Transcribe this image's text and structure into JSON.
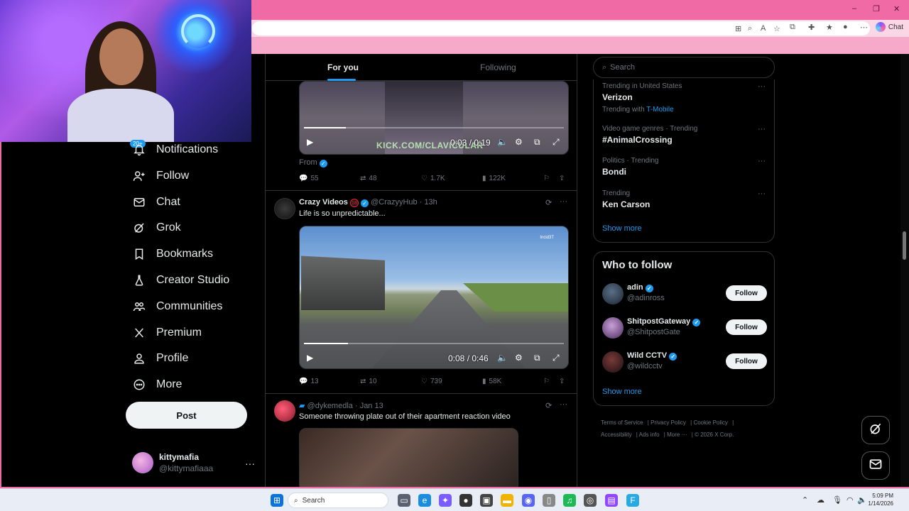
{
  "browser": {
    "chat_label": "Chat",
    "window_controls": [
      "–",
      "❐",
      "✕"
    ]
  },
  "nav": {
    "notifications_badge": "20+",
    "items": [
      {
        "label": "Notifications",
        "icon": "bell-icon"
      },
      {
        "label": "Follow",
        "icon": "person-plus-icon"
      },
      {
        "label": "Chat",
        "icon": "mail-icon"
      },
      {
        "label": "Grok",
        "icon": "grok-icon"
      },
      {
        "label": "Bookmarks",
        "icon": "bookmark-icon"
      },
      {
        "label": "Creator Studio",
        "icon": "flask-icon"
      },
      {
        "label": "Communities",
        "icon": "people-icon"
      },
      {
        "label": "Premium",
        "icon": "x-logo-icon"
      },
      {
        "label": "Profile",
        "icon": "person-icon"
      },
      {
        "label": "More",
        "icon": "more-circle-icon"
      }
    ],
    "post_label": "Post",
    "account": {
      "name": "kittymafia",
      "handle": "@kittymafiaaa"
    }
  },
  "timeline": {
    "tabs": {
      "active": "For you",
      "inactive": "Following"
    },
    "post1": {
      "video_time": "0:03 / 0:19",
      "progress": 0.16,
      "watermark": "KICK.COM/CLAVICULAR",
      "from_label": "From",
      "replies": "55",
      "reposts": "48",
      "likes": "1.7K",
      "views": "122K"
    },
    "post2": {
      "name": "Crazy Videos",
      "age_badge": "18",
      "handle": "@CrazyyHub",
      "time": "· 13h",
      "text": "Life is so unpredictable...",
      "watermark": "Incid3T",
      "video_time": "0:08 / 0:46",
      "progress": 0.17,
      "replies": "13",
      "reposts": "10",
      "likes": "739",
      "views": "58K"
    },
    "post3": {
      "handle": "@dykemedla",
      "time": "· Jan 13",
      "text": "Someone throwing plate out of their apartment reaction video"
    }
  },
  "sidebar": {
    "search_placeholder": "Search",
    "trends": [
      {
        "category": "Trending in United States",
        "title": "Verizon",
        "with_prefix": "Trending with",
        "with_link": "T-Mobile"
      },
      {
        "category": "Video game genres · Trending",
        "title": "#AnimalCrossing"
      },
      {
        "category": "Politics · Trending",
        "title": "Bondi"
      },
      {
        "category": "Trending",
        "title": "Ken Carson"
      }
    ],
    "trends_show_more": "Show more",
    "who_to_follow": {
      "title": "Who to follow",
      "suggestions": [
        {
          "name": "adin",
          "handle": "@adinross",
          "follow": "Follow"
        },
        {
          "name": "ShitpostGateway",
          "handle": "@ShitpostGate",
          "follow": "Follow"
        },
        {
          "name": "Wild CCTV",
          "handle": "@wildcctv",
          "follow": "Follow"
        }
      ],
      "show_more": "Show more"
    },
    "footer": {
      "links": [
        "Terms of Service",
        "Privacy Policy",
        "Cookie Policy",
        "Accessibility",
        "Ads info",
        "More ···"
      ],
      "copyright": "© 2026 X Corp."
    }
  },
  "taskbar": {
    "search_label": "Search",
    "time": "5:09 PM",
    "date": "1/14/2026"
  }
}
